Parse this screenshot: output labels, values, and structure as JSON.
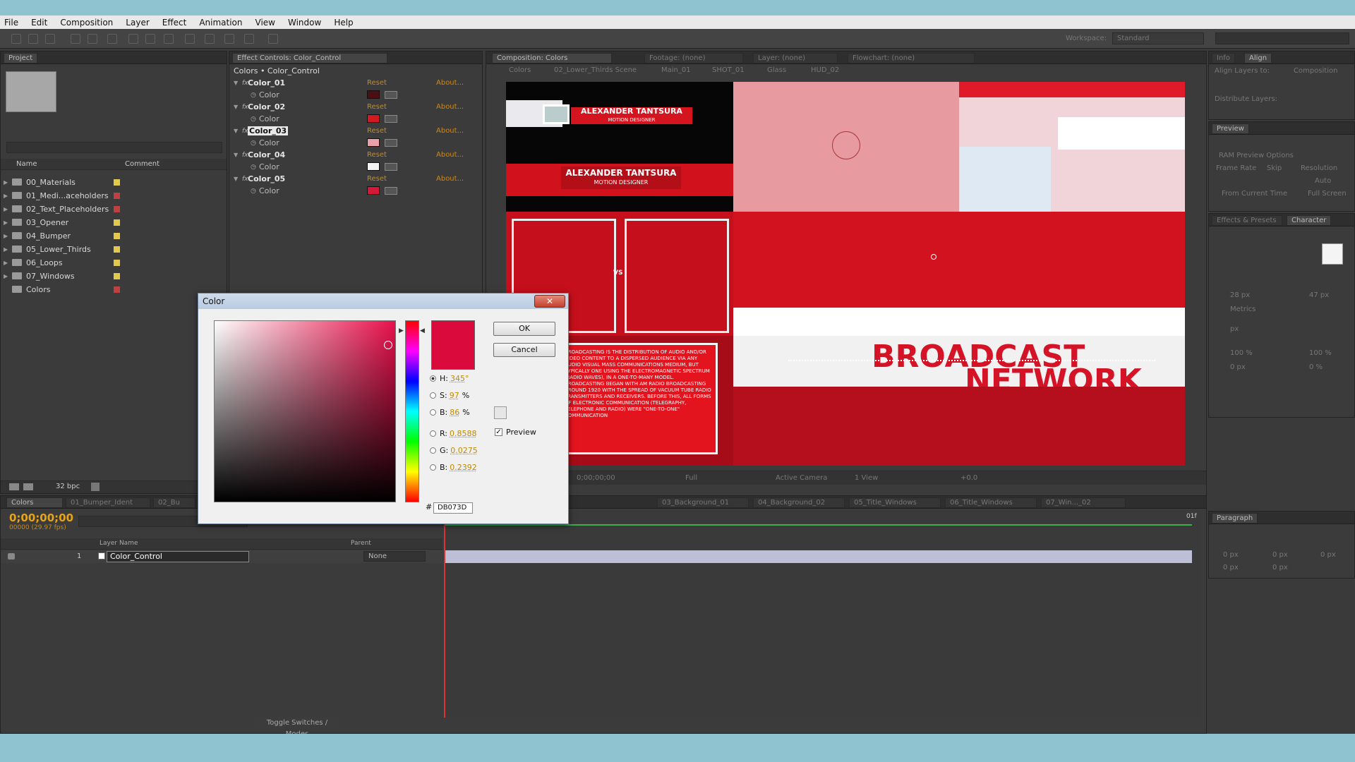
{
  "menu": [
    "File",
    "Edit",
    "Composition",
    "Layer",
    "Effect",
    "Animation",
    "View",
    "Window",
    "Help"
  ],
  "workspace": {
    "label": "Workspace:",
    "value": "Standard"
  },
  "project_panel": {
    "tab": "Project",
    "col_name": "Name",
    "col_comment": "Comment",
    "items": [
      {
        "name": "00_Materials",
        "color": "#e3c84a"
      },
      {
        "name": "01_Medi...aceholders",
        "color": "#c04040"
      },
      {
        "name": "02_Text_Placeholders",
        "color": "#c04040"
      },
      {
        "name": "03_Opener",
        "color": "#e3c84a"
      },
      {
        "name": "04_Bumper",
        "color": "#e3c84a"
      },
      {
        "name": "05_Lower_Thirds",
        "color": "#e3c84a"
      },
      {
        "name": "06_Loops",
        "color": "#e3c84a"
      },
      {
        "name": "07_Windows",
        "color": "#e3c84a"
      },
      {
        "name": "Colors",
        "color": "#c04040"
      }
    ],
    "bpc": "32 bpc"
  },
  "effect_controls": {
    "tab": "Effect Controls: Color_Control",
    "breadcrumb": "Colors • Color_Control",
    "reset": "Reset",
    "about": "About...",
    "sub_label": "Color",
    "effects": [
      {
        "name": "Color_01",
        "swatch": "#4a0f12"
      },
      {
        "name": "Color_02",
        "swatch": "#d31a22"
      },
      {
        "name": "Color_03",
        "swatch": "#e9a0a8"
      },
      {
        "name": "Color_04",
        "swatch": "#f2f2f2"
      },
      {
        "name": "Color_05",
        "swatch": "#d6173a"
      }
    ]
  },
  "composition": {
    "tab": "Composition: Colors",
    "tabs2": [
      "Footage: (none)",
      "Layer: (none)",
      "Flowchart: (none)"
    ],
    "path": [
      "Colors",
      "02_Lower_Thirds Scene",
      "Main_01",
      "SHOT_01",
      "Glass",
      "HUD_02"
    ],
    "bottom_bar": {
      "time": "0;00;00;00",
      "quality": "Full",
      "camera": "Active Camera",
      "views": "1 View",
      "offset": "+0.0"
    },
    "texts": {
      "lt1_name": "ALEXANDER TANTSURA",
      "lt1_role": "MOTION DESIGNER",
      "lt2_name": "ALEXANDER TANTSURA",
      "lt2_role": "MOTION DESIGNER",
      "broadcast": "BROADCAST",
      "network": "NETWORK",
      "vs": "VS",
      "paragraph": "BROADCASTING IS THE DISTRIBUTION OF AUDIO AND/OR VIDEO CONTENT TO A DISPERSED AUDIENCE VIA ANY AUDIO VISUAL MASS COMMUNICATIONS MEDIUM, BUT TYPICALLY ONE USING THE ELECTROMAGNETIC SPECTRUM (RADIO WAVES), IN A ONE-TO-MANY MODEL. BROADCASTING BEGAN WITH AM RADIO BROADCASTING AROUND 1920 WITH THE SPREAD OF VACUUM TUBE RADIO TRANSMITTERS AND RECEIVERS. BEFORE THIS, ALL FORMS OF ELECTRONIC COMMUNICATION (TELEGRAPHY, TELEPHONE AND RADIO) WERE \"ONE-TO-ONE\" COMMUNICATION"
    }
  },
  "color_dialog": {
    "title": "Color",
    "ok": "OK",
    "cancel": "Cancel",
    "preview": "Preview",
    "h_label": "H:",
    "h_value": "345",
    "h_unit": "°",
    "s_label": "S:",
    "s_value": "97",
    "s_unit": "%",
    "b_label": "B:",
    "b_value": "86",
    "b_unit": "%",
    "r_label": "R:",
    "r_value": "0.8588",
    "g_label": "G:",
    "g_value": "0.0275",
    "bb_label": "B:",
    "bb_value": "0.2392",
    "hex_prefix": "#",
    "hex": "DB073D",
    "current_color": "#db0a3d"
  },
  "right_panels": {
    "align": {
      "tab": "Align",
      "align_to": "Align Layers to:",
      "target": "Composition",
      "distribute": "Distribute Layers:"
    },
    "preview": {
      "tab": "Preview",
      "ram": "RAM Preview Options",
      "frame_rate": "Frame Rate",
      "skip": "Skip",
      "resolution": "Resolution",
      "auto": "Auto",
      "from_current": "From Current Time",
      "full_screen": "Full Screen"
    },
    "character": {
      "tab": "Character",
      "tab2": "Effects & Presets",
      "size": "28 px",
      "leading": "47 px",
      "metrics": "Metrics",
      "px": "px",
      "percent1": "100 %",
      "percent2": "100 %",
      "zero_px": "0 px",
      "zero_pct": "0 %"
    },
    "paragraph": {
      "tab": "Paragraph",
      "p1": "0 px",
      "p2": "0 px",
      "p3": "0 px",
      "p4": "0 px",
      "p5": "0 px"
    }
  },
  "timeline": {
    "tabs": [
      "Colors",
      "01_Bumper_Ident",
      "02_Bu"
    ],
    "tabs_right": [
      "03_Background_01",
      "04_Background_02",
      "05_Title_Windows",
      "06_Title_Windows",
      "07_Win..._02"
    ],
    "timecode": "0;00;00;00",
    "fps": "00000 (29.97 fps)",
    "col_layer_name": "Layer Name",
    "col_parent": "Parent",
    "layer_number": "1",
    "layer_name": "Color_Control",
    "parent_value": "None",
    "toggle": "Toggle Switches / Modes",
    "end_marker": "01f"
  }
}
